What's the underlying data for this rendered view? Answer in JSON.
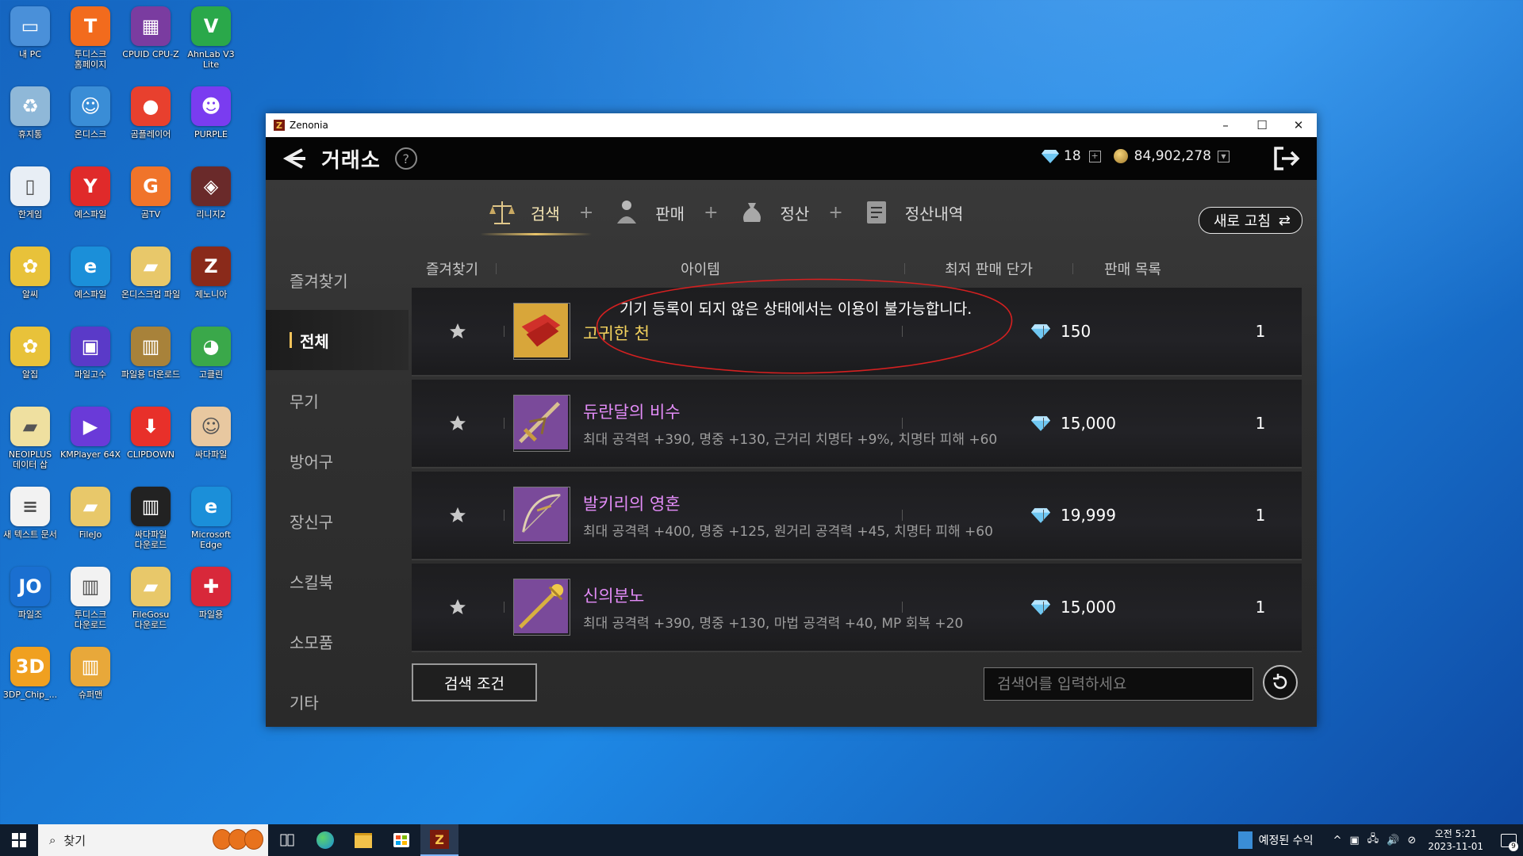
{
  "desktop": {
    "icons": [
      {
        "label": "내 PC",
        "glyph": "▭",
        "color": "#4a90d9"
      },
      {
        "label": "투디스크 홈페이지",
        "glyph": "T",
        "color": "#f26b1d"
      },
      {
        "label": "CPUID CPU-Z",
        "glyph": "▦",
        "color": "#7a3ca0"
      },
      {
        "label": "AhnLab V3 Lite",
        "glyph": "V",
        "color": "#2aa84a"
      },
      {
        "label": "휴지통",
        "glyph": "♻",
        "color": "#8fb8d8"
      },
      {
        "label": "온디스크",
        "glyph": "☺",
        "color": "#3a8dd6"
      },
      {
        "label": "곰플레이어",
        "glyph": "●",
        "color": "#e8402e"
      },
      {
        "label": "PURPLE",
        "glyph": "☻",
        "color": "#7a3cf0"
      },
      {
        "label": "한게임",
        "glyph": "▯",
        "color": "#e8eef5"
      },
      {
        "label": "예스파일",
        "glyph": "Y",
        "color": "#e02a2a"
      },
      {
        "label": "곰TV",
        "glyph": "G",
        "color": "#f0742a"
      },
      {
        "label": "리니지2",
        "glyph": "◈",
        "color": "#6a2a2a"
      },
      {
        "label": "알씨",
        "glyph": "✿",
        "color": "#e8c23a"
      },
      {
        "label": "예스파일",
        "glyph": "e",
        "color": "#1b8fd9"
      },
      {
        "label": "온디스크업 파일",
        "glyph": "▰",
        "color": "#e8c86a"
      },
      {
        "label": "제노니아",
        "glyph": "Z",
        "color": "#8a2a1a"
      },
      {
        "label": "알집",
        "glyph": "✿",
        "color": "#e8c23a"
      },
      {
        "label": "파일고수",
        "glyph": "▣",
        "color": "#5a3ac8"
      },
      {
        "label": "파일용 다운로드",
        "glyph": "▥",
        "color": "#a8823a"
      },
      {
        "label": "고클린",
        "glyph": "◕",
        "color": "#3aa84a"
      },
      {
        "label": "NEOIPLUS 데이터 삽",
        "glyph": "▰",
        "color": "#efe0a0"
      },
      {
        "label": "KMPlayer 64X",
        "glyph": "▶",
        "color": "#6a3ad8"
      },
      {
        "label": "CLIPDOWN",
        "glyph": "⬇",
        "color": "#e8302a"
      },
      {
        "label": "싸다파일",
        "glyph": "☺",
        "color": "#e8c8a0"
      },
      {
        "label": "새 텍스트 문서",
        "glyph": "≡",
        "color": "#f2f2f2"
      },
      {
        "label": "FileJo",
        "glyph": "▰",
        "color": "#e8c86a"
      },
      {
        "label": "싸다파일 다운로드",
        "glyph": "▥",
        "color": "#222222"
      },
      {
        "label": "Microsoft Edge",
        "glyph": "e",
        "color": "#1b8fd9"
      },
      {
        "label": "파일조",
        "glyph": "JO",
        "color": "#1a6fd0"
      },
      {
        "label": "투디스크 다운로드",
        "glyph": "▥",
        "color": "#f2f2f2"
      },
      {
        "label": "FileGosu 다운로드",
        "glyph": "▰",
        "color": "#e8c86a"
      },
      {
        "label": "파일용",
        "glyph": "✚",
        "color": "#d8283a"
      },
      {
        "label": "3DP_Chip_...",
        "glyph": "3D",
        "color": "#f0a020"
      },
      {
        "label": "슈퍼맨",
        "glyph": "▥",
        "color": "#e8a83a"
      }
    ]
  },
  "window": {
    "app_title": "Zenonia",
    "app_icon_glyph": "Z",
    "minimize": "–",
    "maximize": "☐",
    "close": "✕"
  },
  "header": {
    "title": "거래소",
    "help": "?",
    "gems": "18",
    "plus": "+",
    "gold": "84,902,278",
    "dropdown": "▼"
  },
  "tabs": [
    {
      "label": "검색",
      "active": true
    },
    {
      "label": "판매",
      "active": false
    },
    {
      "label": "정산",
      "active": false
    },
    {
      "label": "정산내역",
      "active": false
    }
  ],
  "tab_separator": "+",
  "refresh_button": {
    "label": "새로 고침",
    "glyph": "⇄"
  },
  "sidebar": {
    "favorites": "즐겨찾기",
    "items": [
      {
        "label": "전체",
        "active": true
      },
      {
        "label": "무기",
        "active": false
      },
      {
        "label": "방어구",
        "active": false
      },
      {
        "label": "장신구",
        "active": false
      },
      {
        "label": "스킬북",
        "active": false
      },
      {
        "label": "소모품",
        "active": false
      },
      {
        "label": "기타",
        "active": false
      }
    ]
  },
  "columns": {
    "favorite": "즐겨찾기",
    "item": "아이템",
    "min_price": "최저 판매 단가",
    "listings": "판매 목록"
  },
  "notice": "기기 등록이 되지 않은 상태에서는 이용이 불가능합니다.",
  "rows": [
    {
      "name": "고귀한 천",
      "desc": "",
      "price": "150",
      "count": "1",
      "name_color": "gold"
    },
    {
      "name": "듀란달의 비수",
      "desc": "최대 공격력 +390, 명중 +130, 근거리 치명타 +9%, 치명타 피해 +60",
      "price": "15,000",
      "count": "1",
      "name_color": "purple"
    },
    {
      "name": "발키리의 영혼",
      "desc": "최대 공격력 +400, 명중 +125, 원거리 공격력 +45, 치명타 피해 +60",
      "price": "19,999",
      "count": "1",
      "name_color": "purple"
    },
    {
      "name": "신의분노",
      "desc": "최대 공격력 +390, 명중 +130, 마법 공격력 +40, MP 회복 +20",
      "price": "15,000",
      "count": "1",
      "name_color": "purple"
    }
  ],
  "search": {
    "condition_label": "검색 조건",
    "placeholder": "검색어를 입력하세요"
  },
  "taskbar": {
    "search_label": "찾기",
    "weather": "예정된 수익",
    "tray_lang": "^",
    "time": "오전 5:21",
    "date": "2023-11-01",
    "notifications": "9"
  },
  "colors": {
    "accent_gold": "#f0c25a",
    "item_purple": "#e38cf8",
    "item_gold": "#f4d35e",
    "desktop_blue": "#1976d2"
  }
}
